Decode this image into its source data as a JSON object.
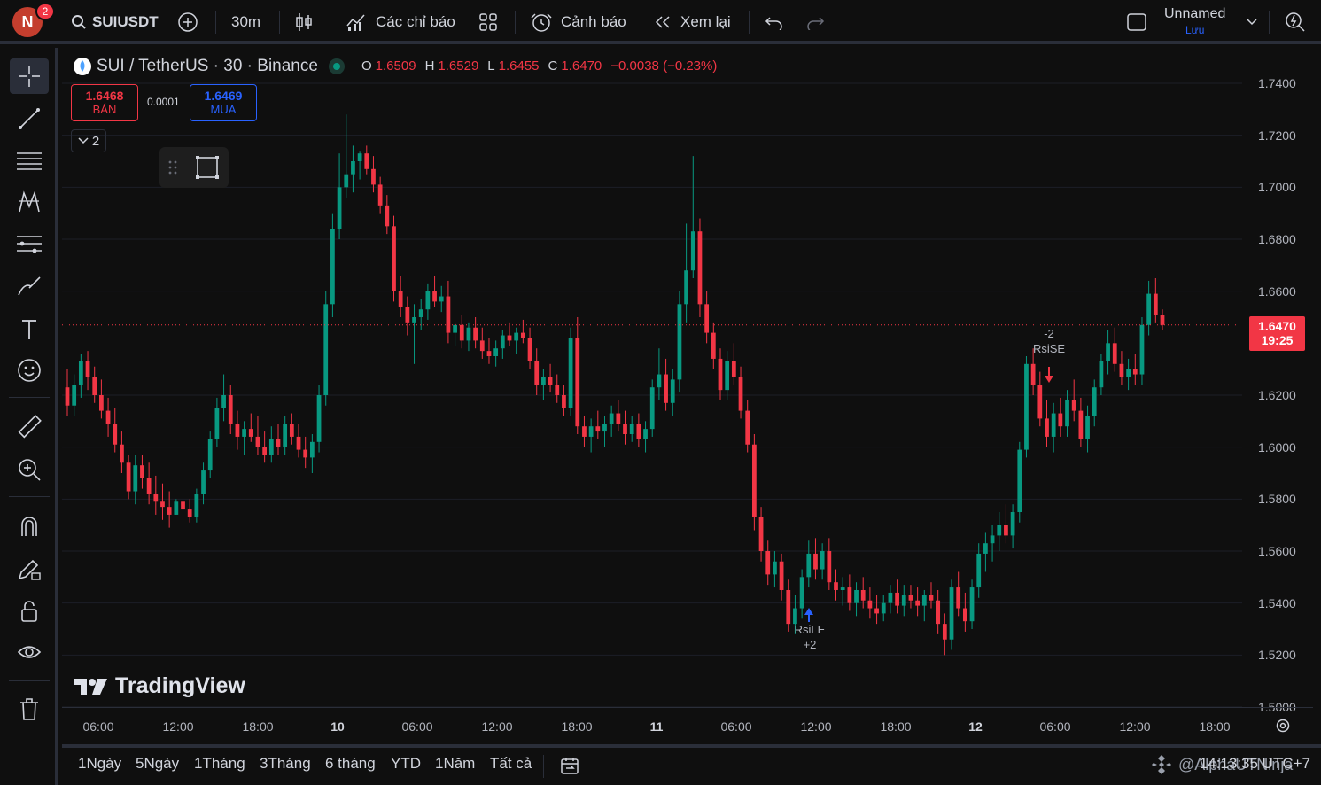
{
  "topbar": {
    "avatar_letter": "N",
    "notification_count": "2",
    "symbol": "SUIUSDT",
    "interval": "30m",
    "indicators_label": "Các chỉ báo",
    "alerts_label": "Cảnh báo",
    "replay_label": "Xem lại",
    "layout_name": "Unnamed",
    "layout_status": "Lưu"
  },
  "legend": {
    "title": "SUI / TetherUS · 30 · Binance",
    "open_key": "O",
    "open": "1.6509",
    "high_key": "H",
    "high": "1.6529",
    "low_key": "L",
    "low": "1.6455",
    "close_key": "C",
    "close": "1.6470",
    "change": "−0.0038 (−0.23%)"
  },
  "trade": {
    "sell_price": "1.6468",
    "sell_label": "BÁN",
    "spread": "0.0001",
    "buy_price": "1.6469",
    "buy_label": "MUA",
    "collapsed_count": "2"
  },
  "chart_data": {
    "type": "candlestick",
    "symbol": "SUI / TetherUS",
    "interval": "30",
    "exchange": "Binance",
    "price_axis_ticks": [
      "1.7400",
      "1.7200",
      "1.7000",
      "1.6800",
      "1.6600",
      "1.6200",
      "1.6000",
      "1.5800",
      "1.5600",
      "1.5400",
      "1.5200",
      "1.5000"
    ],
    "ylim": [
      1.5,
      1.745
    ],
    "time_axis_ticks": [
      {
        "label": "06:00",
        "bold": false
      },
      {
        "label": "12:00",
        "bold": false
      },
      {
        "label": "18:00",
        "bold": false
      },
      {
        "label": "10",
        "bold": true
      },
      {
        "label": "06:00",
        "bold": false
      },
      {
        "label": "12:00",
        "bold": false
      },
      {
        "label": "18:00",
        "bold": false
      },
      {
        "label": "11",
        "bold": true
      },
      {
        "label": "06:00",
        "bold": false
      },
      {
        "label": "12:00",
        "bold": false
      },
      {
        "label": "18:00",
        "bold": false
      },
      {
        "label": "12",
        "bold": true
      },
      {
        "label": "06:00",
        "bold": false
      },
      {
        "label": "12:00",
        "bold": false
      },
      {
        "label": "18:00",
        "bold": false
      }
    ],
    "current_price": "1.6470",
    "countdown": "19:25",
    "up_color": "#089981",
    "down_color": "#f23645",
    "signals": [
      {
        "name": "RsiLE",
        "value": "+2",
        "direction": "long"
      },
      {
        "name": "RsiSE",
        "value": "-2",
        "direction": "short"
      }
    ],
    "candles": [
      [
        1.623,
        1.63,
        1.612,
        1.616
      ],
      [
        1.616,
        1.628,
        1.612,
        1.624
      ],
      [
        1.624,
        1.636,
        1.619,
        1.633
      ],
      [
        1.633,
        1.637,
        1.622,
        1.627
      ],
      [
        1.627,
        1.631,
        1.617,
        1.62
      ],
      [
        1.62,
        1.626,
        1.611,
        1.614
      ],
      [
        1.614,
        1.619,
        1.604,
        1.609
      ],
      [
        1.609,
        1.615,
        1.598,
        1.601
      ],
      [
        1.601,
        1.606,
        1.59,
        1.594
      ],
      [
        1.594,
        1.597,
        1.58,
        1.583
      ],
      [
        1.583,
        1.597,
        1.578,
        1.593
      ],
      [
        1.593,
        1.597,
        1.584,
        1.588
      ],
      [
        1.588,
        1.594,
        1.578,
        1.582
      ],
      [
        1.582,
        1.589,
        1.574,
        1.579
      ],
      [
        1.579,
        1.586,
        1.572,
        1.577
      ],
      [
        1.577,
        1.583,
        1.569,
        1.574
      ],
      [
        1.574,
        1.58,
        1.574,
        1.579
      ],
      [
        1.579,
        1.582,
        1.573,
        1.576
      ],
      [
        1.576,
        1.58,
        1.571,
        1.573
      ],
      [
        1.573,
        1.584,
        1.571,
        1.582
      ],
      [
        1.582,
        1.594,
        1.578,
        1.591
      ],
      [
        1.591,
        1.606,
        1.588,
        1.603
      ],
      [
        1.603,
        1.619,
        1.6,
        1.615
      ],
      [
        1.615,
        1.628,
        1.61,
        1.62
      ],
      [
        1.62,
        1.624,
        1.605,
        1.609
      ],
      [
        1.609,
        1.614,
        1.599,
        1.604
      ],
      [
        1.604,
        1.61,
        1.597,
        1.607
      ],
      [
        1.607,
        1.613,
        1.602,
        1.604
      ],
      [
        1.604,
        1.612,
        1.597,
        1.6
      ],
      [
        1.6,
        1.606,
        1.594,
        1.597
      ],
      [
        1.597,
        1.608,
        1.594,
        1.603
      ],
      [
        1.603,
        1.609,
        1.597,
        1.6
      ],
      [
        1.6,
        1.612,
        1.597,
        1.609
      ],
      [
        1.609,
        1.613,
        1.601,
        1.604
      ],
      [
        1.604,
        1.609,
        1.596,
        1.599
      ],
      [
        1.599,
        1.604,
        1.592,
        1.596
      ],
      [
        1.596,
        1.605,
        1.59,
        1.602
      ],
      [
        1.602,
        1.624,
        1.598,
        1.62
      ],
      [
        1.62,
        1.66,
        1.616,
        1.655
      ],
      [
        1.655,
        1.69,
        1.65,
        1.684
      ],
      [
        1.684,
        1.713,
        1.68,
        1.7
      ],
      [
        1.7,
        1.728,
        1.696,
        1.705
      ],
      [
        1.705,
        1.716,
        1.698,
        1.71
      ],
      [
        1.71,
        1.714,
        1.703,
        1.713
      ],
      [
        1.713,
        1.716,
        1.705,
        1.707
      ],
      [
        1.707,
        1.712,
        1.698,
        1.701
      ],
      [
        1.701,
        1.704,
        1.69,
        1.693
      ],
      [
        1.693,
        1.697,
        1.682,
        1.685
      ],
      [
        1.685,
        1.689,
        1.656,
        1.66
      ],
      [
        1.66,
        1.666,
        1.65,
        1.654
      ],
      [
        1.654,
        1.658,
        1.643,
        1.648
      ],
      [
        1.648,
        1.655,
        1.632,
        1.65
      ],
      [
        1.65,
        1.657,
        1.645,
        1.653
      ],
      [
        1.653,
        1.663,
        1.649,
        1.66
      ],
      [
        1.66,
        1.666,
        1.654,
        1.656
      ],
      [
        1.656,
        1.662,
        1.652,
        1.658
      ],
      [
        1.658,
        1.664,
        1.64,
        1.644
      ],
      [
        1.644,
        1.648,
        1.639,
        1.647
      ],
      [
        1.647,
        1.651,
        1.638,
        1.641
      ],
      [
        1.641,
        1.648,
        1.637,
        1.646
      ],
      [
        1.646,
        1.65,
        1.638,
        1.641
      ],
      [
        1.641,
        1.646,
        1.634,
        1.637
      ],
      [
        1.637,
        1.642,
        1.632,
        1.635
      ],
      [
        1.635,
        1.641,
        1.631,
        1.638
      ],
      [
        1.638,
        1.645,
        1.634,
        1.643
      ],
      [
        1.643,
        1.648,
        1.639,
        1.641
      ],
      [
        1.641,
        1.646,
        1.636,
        1.644
      ],
      [
        1.644,
        1.649,
        1.64,
        1.642
      ],
      [
        1.642,
        1.646,
        1.63,
        1.633
      ],
      [
        1.633,
        1.638,
        1.62,
        1.624
      ],
      [
        1.624,
        1.63,
        1.618,
        1.627
      ],
      [
        1.627,
        1.632,
        1.621,
        1.624
      ],
      [
        1.624,
        1.628,
        1.617,
        1.62
      ],
      [
        1.62,
        1.624,
        1.612,
        1.615
      ],
      [
        1.615,
        1.646,
        1.612,
        1.642
      ],
      [
        1.642,
        1.65,
        1.605,
        1.608
      ],
      [
        1.608,
        1.612,
        1.6,
        1.604
      ],
      [
        1.604,
        1.611,
        1.598,
        1.608
      ],
      [
        1.608,
        1.614,
        1.603,
        1.606
      ],
      [
        1.606,
        1.612,
        1.6,
        1.609
      ],
      [
        1.609,
        1.616,
        1.604,
        1.613
      ],
      [
        1.613,
        1.618,
        1.606,
        1.609
      ],
      [
        1.609,
        1.614,
        1.601,
        1.605
      ],
      [
        1.605,
        1.612,
        1.602,
        1.609
      ],
      [
        1.609,
        1.613,
        1.6,
        1.603
      ],
      [
        1.603,
        1.61,
        1.598,
        1.607
      ],
      [
        1.607,
        1.626,
        1.604,
        1.623
      ],
      [
        1.623,
        1.638,
        1.618,
        1.628
      ],
      [
        1.628,
        1.634,
        1.614,
        1.617
      ],
      [
        1.617,
        1.63,
        1.612,
        1.626
      ],
      [
        1.626,
        1.66,
        1.621,
        1.655
      ],
      [
        1.655,
        1.686,
        1.648,
        1.668
      ],
      [
        1.668,
        1.712,
        1.665,
        1.683
      ],
      [
        1.683,
        1.688,
        1.65,
        1.655
      ],
      [
        1.655,
        1.66,
        1.64,
        1.644
      ],
      [
        1.644,
        1.648,
        1.63,
        1.634
      ],
      [
        1.634,
        1.638,
        1.618,
        1.622
      ],
      [
        1.622,
        1.637,
        1.618,
        1.633
      ],
      [
        1.633,
        1.64,
        1.624,
        1.627
      ],
      [
        1.627,
        1.631,
        1.611,
        1.614
      ],
      [
        1.614,
        1.618,
        1.598,
        1.601
      ],
      [
        1.601,
        1.605,
        1.568,
        1.573
      ],
      [
        1.573,
        1.577,
        1.556,
        1.56
      ],
      [
        1.56,
        1.564,
        1.547,
        1.551
      ],
      [
        1.551,
        1.56,
        1.546,
        1.556
      ],
      [
        1.556,
        1.559,
        1.541,
        1.545
      ],
      [
        1.545,
        1.549,
        1.529,
        1.532
      ],
      [
        1.532,
        1.543,
        1.528,
        1.538
      ],
      [
        1.538,
        1.553,
        1.534,
        1.55
      ],
      [
        1.55,
        1.564,
        1.546,
        1.559
      ],
      [
        1.559,
        1.565,
        1.549,
        1.553
      ],
      [
        1.553,
        1.563,
        1.549,
        1.56
      ],
      [
        1.56,
        1.565,
        1.545,
        1.548
      ],
      [
        1.548,
        1.553,
        1.541,
        1.545
      ],
      [
        1.545,
        1.55,
        1.539,
        1.546
      ],
      [
        1.546,
        1.551,
        1.537,
        1.54
      ],
      [
        1.54,
        1.548,
        1.535,
        1.545
      ],
      [
        1.545,
        1.55,
        1.538,
        1.541
      ],
      [
        1.541,
        1.546,
        1.534,
        1.538
      ],
      [
        1.538,
        1.543,
        1.532,
        1.536
      ],
      [
        1.536,
        1.543,
        1.533,
        1.54
      ],
      [
        1.54,
        1.547,
        1.536,
        1.544
      ],
      [
        1.544,
        1.549,
        1.536,
        1.539
      ],
      [
        1.539,
        1.547,
        1.535,
        1.543
      ],
      [
        1.543,
        1.547,
        1.538,
        1.541
      ],
      [
        1.541,
        1.546,
        1.535,
        1.539
      ],
      [
        1.539,
        1.545,
        1.533,
        1.543
      ],
      [
        1.543,
        1.548,
        1.538,
        1.541
      ],
      [
        1.541,
        1.545,
        1.528,
        1.532
      ],
      [
        1.532,
        1.536,
        1.52,
        1.526
      ],
      [
        1.526,
        1.549,
        1.522,
        1.546
      ],
      [
        1.546,
        1.552,
        1.535,
        1.538
      ],
      [
        1.538,
        1.544,
        1.529,
        1.533
      ],
      [
        1.533,
        1.549,
        1.53,
        1.546
      ],
      [
        1.546,
        1.563,
        1.542,
        1.559
      ],
      [
        1.559,
        1.567,
        1.552,
        1.563
      ],
      [
        1.563,
        1.57,
        1.556,
        1.566
      ],
      [
        1.566,
        1.575,
        1.56,
        1.57
      ],
      [
        1.57,
        1.578,
        1.563,
        1.566
      ],
      [
        1.566,
        1.578,
        1.561,
        1.575
      ],
      [
        1.575,
        1.602,
        1.571,
        1.599
      ],
      [
        1.599,
        1.635,
        1.596,
        1.632
      ],
      [
        1.632,
        1.638,
        1.62,
        1.624
      ],
      [
        1.624,
        1.629,
        1.608,
        1.611
      ],
      [
        1.611,
        1.618,
        1.6,
        1.604
      ],
      [
        1.604,
        1.617,
        1.598,
        1.613
      ],
      [
        1.613,
        1.619,
        1.604,
        1.608
      ],
      [
        1.608,
        1.622,
        1.604,
        1.618
      ],
      [
        1.618,
        1.626,
        1.61,
        1.614
      ],
      [
        1.614,
        1.619,
        1.6,
        1.603
      ],
      [
        1.603,
        1.616,
        1.598,
        1.612
      ],
      [
        1.612,
        1.626,
        1.608,
        1.623
      ],
      [
        1.623,
        1.636,
        1.62,
        1.633
      ],
      [
        1.633,
        1.645,
        1.628,
        1.64
      ],
      [
        1.64,
        1.646,
        1.629,
        1.632
      ],
      [
        1.632,
        1.637,
        1.624,
        1.627
      ],
      [
        1.627,
        1.634,
        1.622,
        1.63
      ],
      [
        1.63,
        1.636,
        1.624,
        1.628
      ],
      [
        1.628,
        1.65,
        1.624,
        1.647
      ],
      [
        1.647,
        1.664,
        1.643,
        1.659
      ],
      [
        1.659,
        1.665,
        1.648,
        1.651
      ],
      [
        1.651,
        1.653,
        1.645,
        1.647
      ]
    ]
  },
  "ranges": [
    "1Ngày",
    "5Ngày",
    "1Tháng",
    "3Tháng",
    "6 tháng",
    "YTD",
    "1Năm",
    "Tất cả"
  ],
  "clock": "14:13:35 UTC+7",
  "brand": "TradingView",
  "watermark": "@AlphaUTNinja"
}
